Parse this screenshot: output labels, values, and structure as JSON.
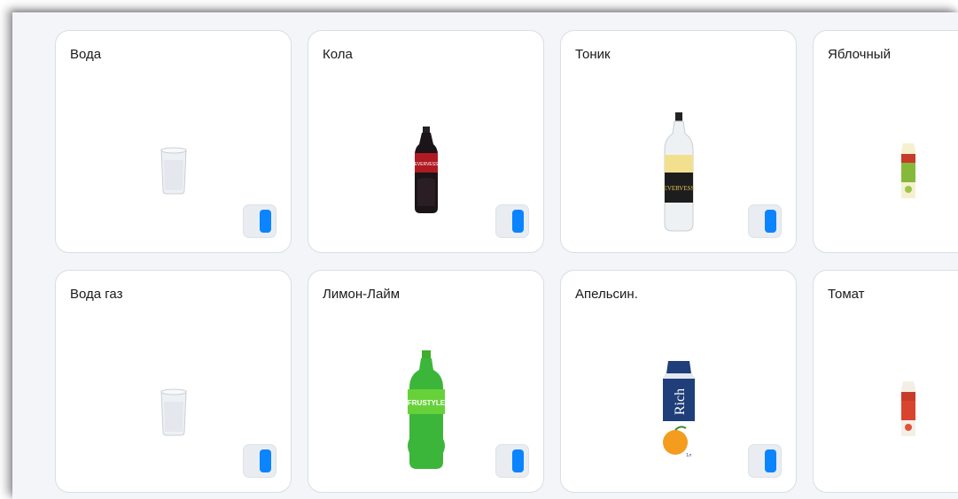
{
  "products": [
    {
      "name": "Вода",
      "image": "water-glass-icon",
      "enabled": true
    },
    {
      "name": "Кола",
      "image": "cola-bottle-icon",
      "enabled": true
    },
    {
      "name": "Тоник",
      "image": "tonic-bottle-icon",
      "enabled": true
    },
    {
      "name": "Яблочный",
      "image": "apple-juice-pack-icon",
      "enabled": true
    },
    {
      "name": "Вода газ",
      "image": "sparkling-water-glass-icon",
      "enabled": true
    },
    {
      "name": "Лимон-Лайм",
      "image": "lemon-lime-bottle-icon",
      "enabled": true
    },
    {
      "name": "Апельсин.",
      "image": "orange-juice-pack-icon",
      "enabled": true
    },
    {
      "name": "Томат",
      "image": "tomato-juice-pack-icon",
      "enabled": true
    }
  ],
  "labels": {
    "cola_brand": "EVERVESS",
    "tonic_brand": "EVERVESS",
    "lemonlime_brand": "FRUSTYLE",
    "orange_brand": "Rich",
    "orange_volume": "1л"
  },
  "colors": {
    "accent": "#0a84ff",
    "card_background": "#ffffff",
    "screen_background": "#f3f5f8"
  }
}
